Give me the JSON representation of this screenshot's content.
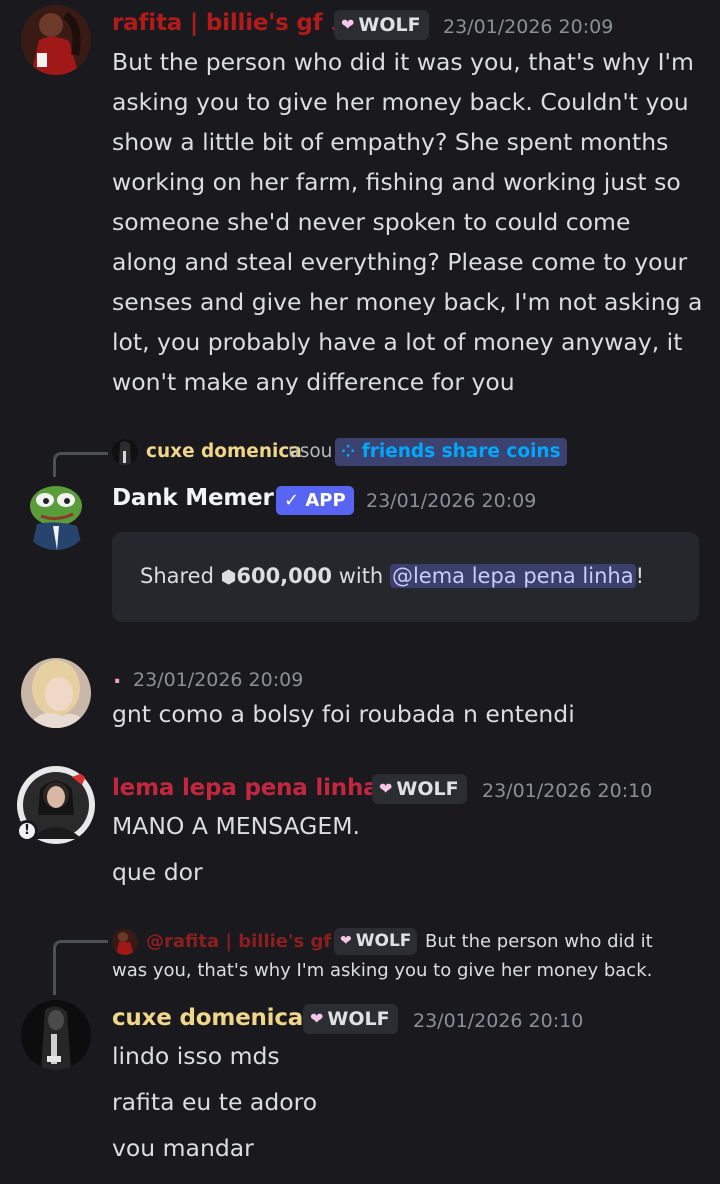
{
  "colors": {
    "background": "#1a1a1e",
    "rafita_name": "#b31b1b",
    "lema_name": "#c2273f",
    "cuxe_name": "#f0d68a",
    "app_badge": "#5865f2",
    "mention_bg": "#3b3f6b"
  },
  "messages": {
    "m1": {
      "author": "rafita | billie's gf ♪",
      "tag": "WOLF",
      "timestamp": "23/01/2026 20:09",
      "lines": [
        "But the person who did it was you, that's why I'm",
        "asking you to give her money back. Couldn't you",
        "show a little bit of empathy? She spent months",
        "working on her farm, fishing and working just so",
        "someone she'd never spoken to could come",
        "along and steal everything? Please come to your",
        "senses and give her money back, I'm not asking a",
        "lot, you probably have a lot of money anyway, it",
        "won't make any difference for you"
      ]
    },
    "m2": {
      "interaction_user": "cuxe domenica",
      "interaction_verb": "usou",
      "command": "friends share coins",
      "author": "Dank Memer",
      "badge": "✓ APP",
      "timestamp": "23/01/2026 20:09",
      "embed_prefix": "Shared",
      "coin_icon": "coin-icon",
      "amount": "600,000",
      "embed_with": "with",
      "mention": "@lema lepa pena linha",
      "embed_suffix": "!"
    },
    "m3": {
      "author": ".",
      "timestamp": "23/01/2026 20:09",
      "lines": [
        "gnt como a bolsy foi roubada n entendi"
      ]
    },
    "m4": {
      "author": "lema lepa pena linha",
      "tag": "WOLF",
      "timestamp": "23/01/2026 20:10",
      "lines": [
        "MANO A MENSAGEM.",
        "que dor"
      ]
    },
    "m5": {
      "reply_author": "@rafita | billie's gf ♪",
      "reply_tag": "WOLF",
      "reply_text_1": "But the person who did it",
      "reply_text_2": "was you, that's why I'm asking you to give her money back.",
      "author": "cuxe domenica",
      "tag": "WOLF",
      "timestamp": "23/01/2026 20:10",
      "lines": [
        "lindo isso mds",
        "rafita eu te adoro",
        "vou mandar"
      ]
    }
  }
}
